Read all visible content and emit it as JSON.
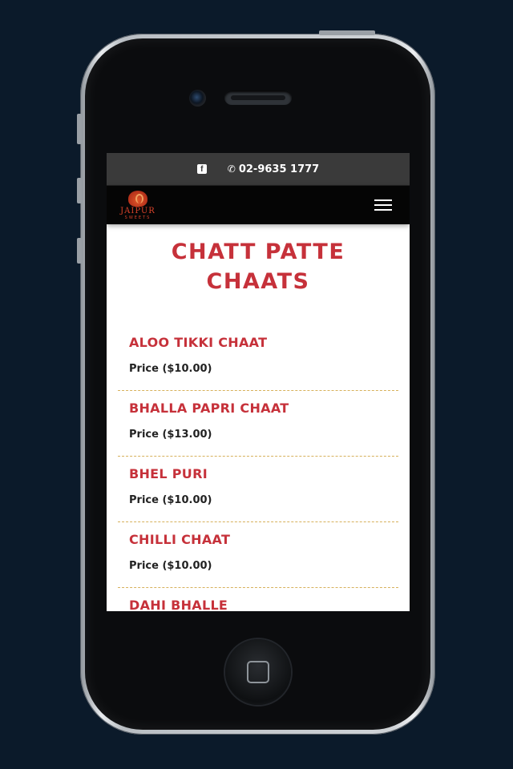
{
  "topbar": {
    "facebook_icon": "facebook-icon",
    "phone_icon": "phone-icon",
    "phone_number": "02-9635 1777"
  },
  "navbar": {
    "logo_name": "JAIPUR",
    "logo_sub": "SWEETS",
    "menu_icon": "hamburger-icon"
  },
  "page": {
    "title": "CHATT PATTE CHAATS"
  },
  "menu_items": [
    {
      "name": "ALOO TIKKI CHAAT",
      "price": "Price ($10.00)"
    },
    {
      "name": "BHALLA PAPRI CHAAT",
      "price": "Price ($13.00)"
    },
    {
      "name": "BHEL PURI",
      "price": "Price ($10.00)"
    },
    {
      "name": "CHILLI CHAAT",
      "price": "Price ($10.00)"
    },
    {
      "name": "DAHI BHALLE",
      "price": ""
    }
  ],
  "colors": {
    "accent": "#c6313a",
    "topbar_bg": "#3a3a3a",
    "navbar_bg": "#050505",
    "divider": "#d7b15c",
    "backdrop": "#0b1a2a"
  }
}
